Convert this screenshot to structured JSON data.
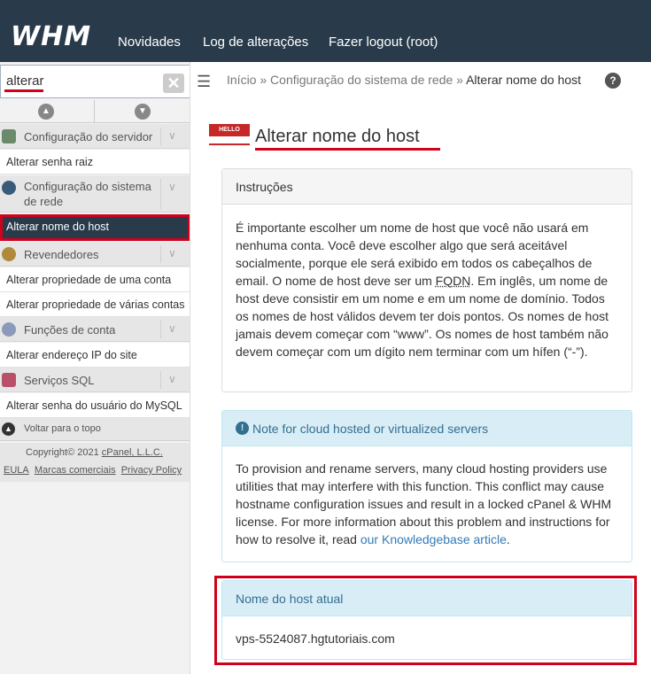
{
  "header": {
    "logo": "WHM",
    "nav": [
      "Novidades",
      "Log de alterações",
      "Fazer logout (root)"
    ]
  },
  "search": {
    "value": "alterar",
    "clear_icon": "close-icon"
  },
  "sidebar": {
    "sections": [
      {
        "label": "Configuração do servidor",
        "icon": "server-icon",
        "items": [
          "Alterar senha raiz"
        ]
      },
      {
        "label": "Configuração do sistema de rede",
        "icon": "network-icon",
        "items": [
          "Alterar nome do host"
        ]
      },
      {
        "label": "Revendedores",
        "icon": "reseller-icon",
        "items": [
          "Alterar propriedade de uma conta",
          "Alterar propriedade de várias contas"
        ]
      },
      {
        "label": "Funções de conta",
        "icon": "user-icon",
        "items": [
          "Alterar endereço IP do site"
        ]
      },
      {
        "label": "Serviços SQL",
        "icon": "database-icon",
        "items": [
          "Alterar senha do usuário do MySQL"
        ]
      }
    ],
    "active_item": "Alterar nome do host",
    "back_to_top": "Voltar para o topo",
    "copyright": "Copyright© 2021",
    "copyright_link": "cPanel, L.L.C.",
    "footer_links": [
      "EULA",
      "Marcas comerciais",
      "Privacy Policy"
    ]
  },
  "breadcrumb": {
    "items": [
      "Início",
      "Configuração do sistema de rede"
    ],
    "separator": "»",
    "current": "Alterar nome do host"
  },
  "page": {
    "icon_badge": "HELLO",
    "title": "Alterar nome do host"
  },
  "instructions": {
    "title": "Instruções",
    "text_before": "É importante escolher um nome de host que você não usará em nenhuma conta. Você deve escolher algo que será aceitável socialmente, porque ele será exibido em todos os cabeçalhos de email. O nome de host deve ser um ",
    "abbr": "FQDN",
    "text_after": ". Em inglês, um nome de host deve consistir em um nome e em um nome de domínio. Todos os nomes de host válidos devem ter dois pontos. Os nomes de host jamais devem começar com “www”. Os nomes de host também não devem começar com um dígito nem terminar com um hífen (“-”)."
  },
  "cloud_note": {
    "title": "Note for cloud hosted or virtualized servers",
    "text": "To provision and rename servers, many cloud hosting providers use utilities that may interfere with this function. This conflict may cause hostname configuration issues and result in a locked cPanel & WHM license. For more information about this problem and instructions for how to resolve it, read ",
    "link": "our Knowledgebase article",
    "text_end": "."
  },
  "current_host": {
    "title": "Nome do host atual",
    "value": "vps-5524087.hgtutoriais.com"
  },
  "colors": {
    "topbar": "#293a4a",
    "highlight": "#d0021b",
    "info_bg": "#d9edf7",
    "link": "#337ab7"
  }
}
